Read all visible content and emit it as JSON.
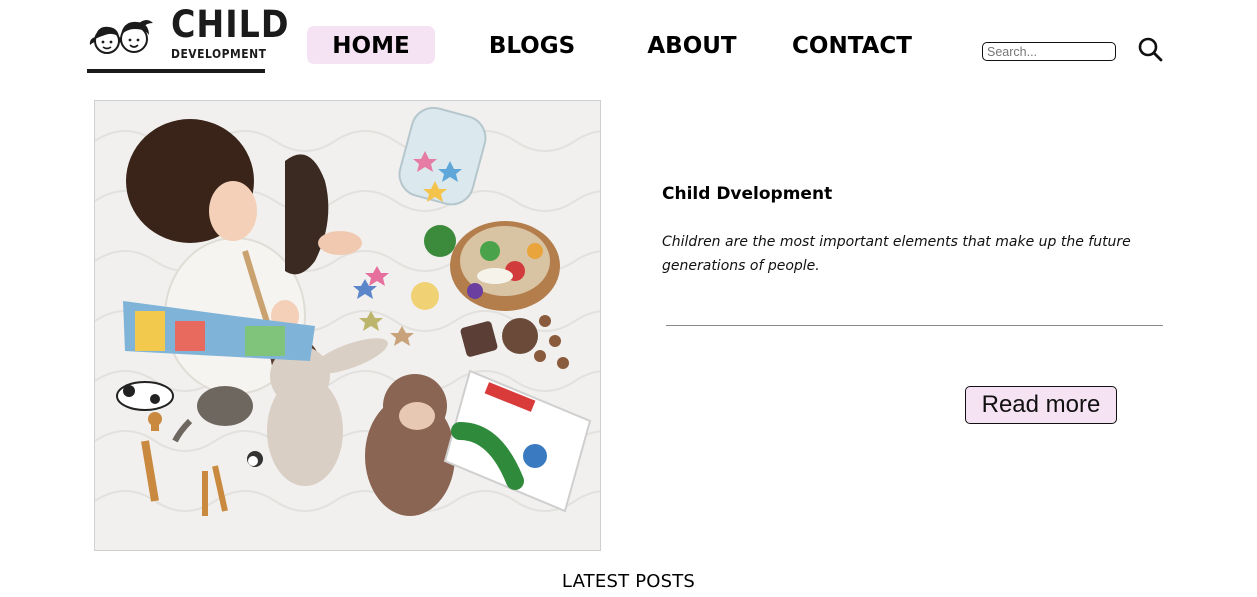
{
  "header": {
    "logo": {
      "word_1": "CHILD",
      "word_2": "DEVELOPMENT"
    },
    "nav": [
      {
        "label": "HOME",
        "active": true
      },
      {
        "label": "BLOGS",
        "active": false
      },
      {
        "label": "ABOUT",
        "active": false
      },
      {
        "label": "CONTACT",
        "active": false
      }
    ],
    "search": {
      "placeholder": "Search...",
      "value": "",
      "icon": "search-icon"
    }
  },
  "hero": {
    "image_alt": "Baby playing with toys on a white blanket",
    "post_title": "Child Dvelopment",
    "post_excerpt": "Children are the most important elements that make up the future generations of people.",
    "read_more_label": "Read more"
  },
  "section": {
    "latest_posts_label": "LATEST POSTS"
  },
  "colors": {
    "accent_bg": "#f5e3f3",
    "text": "#000000",
    "divider": "#8a8a8a"
  }
}
